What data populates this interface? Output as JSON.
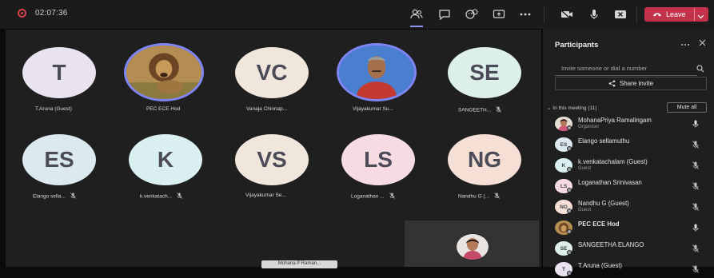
{
  "topbar": {
    "timer": "02:07:36",
    "leave_label": "Leave"
  },
  "tiles": [
    {
      "initials": "T",
      "name": "T.Aruna (Guest)",
      "color": "#e8e3ee",
      "muted": false,
      "photo": null
    },
    {
      "initials": "",
      "name": "PEC ECE Hod",
      "color": "#9b7a3e",
      "muted": false,
      "photo": "lion"
    },
    {
      "initials": "VC",
      "name": "Vanaja Chinnap...",
      "color": "#f1e6dc",
      "muted": false,
      "photo": null
    },
    {
      "initials": "",
      "name": "Vijayakumar Su...",
      "color": "#3b6db8",
      "muted": false,
      "photo": "person"
    },
    {
      "initials": "SE",
      "name": "SANGEETH...",
      "color": "#dcefe8",
      "muted": true,
      "photo": null
    },
    {
      "initials": "ES",
      "name": "Elango sella...",
      "color": "#dceaf0",
      "muted": true,
      "photo": null
    },
    {
      "initials": "K",
      "name": "k.venkatach...",
      "color": "#d9eff0",
      "muted": true,
      "photo": null
    },
    {
      "initials": "VS",
      "name": "Vijayakumar Se...",
      "color": "#f1e6dc",
      "muted": false,
      "photo": null
    },
    {
      "initials": "LS",
      "name": "Loganathan ...",
      "color": "#f6dbe3",
      "muted": true,
      "photo": null
    },
    {
      "initials": "NG",
      "name": "Nandhu G (...",
      "color": "#f6e0d6",
      "muted": true,
      "photo": null
    }
  ],
  "bottom_label": "Mohana P Raman...",
  "panel": {
    "title": "Participants",
    "invite_placeholder": "Invite someone or dial a number",
    "share_invite_label": "Share invite",
    "meeting_section_label": "In this meeting (11)",
    "mute_all_label": "Mute all",
    "participants": [
      {
        "name": "MohanaPriya Ramalingam",
        "sub": "Organiser",
        "initials": "",
        "color": "#c98b6b",
        "bold": false
      },
      {
        "name": "Elango sellamuthu",
        "sub": "",
        "initials": "ES",
        "color": "#dceaf0",
        "bold": false
      },
      {
        "name": "k.venkatachalam (Guest)",
        "sub": "Guest",
        "initials": "K",
        "color": "#d9eff0",
        "bold": false
      },
      {
        "name": "Loganathan Srinivasan",
        "sub": "",
        "initials": "LS",
        "color": "#f6dbe3",
        "bold": false
      },
      {
        "name": "Nandhu G (Guest)",
        "sub": "Guest",
        "initials": "NG",
        "color": "#f6e0d6",
        "bold": false
      },
      {
        "name": "PEC ECE Hod",
        "sub": "",
        "initials": "",
        "color": "#9b7a3e",
        "bold": true
      },
      {
        "name": "SANGEETHA ELANGO",
        "sub": "",
        "initials": "SE",
        "color": "#dcefe8",
        "bold": false
      },
      {
        "name": "T.Aruna (Guest)",
        "sub": "",
        "initials": "T",
        "color": "#e8e3ee",
        "bold": false
      }
    ]
  }
}
